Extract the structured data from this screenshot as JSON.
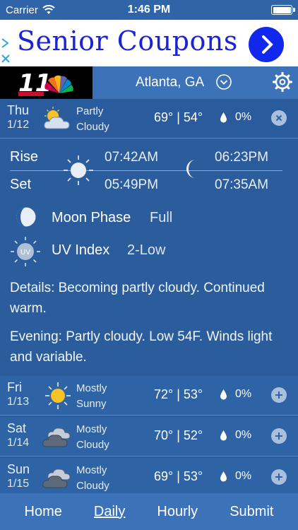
{
  "status_bar": {
    "carrier": "Carrier",
    "time": "1:46 PM"
  },
  "ad": {
    "text": "Senior Coupons"
  },
  "header": {
    "location": "Atlanta, GA"
  },
  "today": {
    "day": "Thu",
    "date": "1/12",
    "condition_line1": "Partly",
    "condition_line2": "Cloudy",
    "temps": "69° | 54°",
    "precip": "0%",
    "icon": "partly-cloudy-icon"
  },
  "details": {
    "rise_label": "Rise",
    "set_label": "Set",
    "sunrise": "07:42AM",
    "sunset": "05:49PM",
    "moonrise": "06:23PM",
    "moonset": "07:35AM",
    "moon_phase_label": "Moon Phase",
    "moon_phase_value": "Full",
    "uv_label": "UV Index",
    "uv_value": "2-Low",
    "uv_badge": "UV",
    "details_text": "Details: Becoming partly cloudy. Continued warm.",
    "evening_text": "Evening: Partly cloudy. Low 54F. Winds light and variable."
  },
  "forecast": [
    {
      "day": "Fri",
      "date": "1/13",
      "condition_line1": "Mostly",
      "condition_line2": "Sunny",
      "temps": "72° | 53°",
      "precip": "0%",
      "icon": "sunny-icon"
    },
    {
      "day": "Sat",
      "date": "1/14",
      "condition_line1": "Mostly",
      "condition_line2": "Cloudy",
      "temps": "70° | 52°",
      "precip": "0%",
      "icon": "cloudy-icon"
    },
    {
      "day": "Sun",
      "date": "1/15",
      "condition_line1": "Mostly",
      "condition_line2": "Cloudy",
      "temps": "69° | 53°",
      "precip": "0%",
      "icon": "cloudy-icon"
    }
  ],
  "nav": {
    "home": "Home",
    "daily": "Daily",
    "hourly": "Hourly",
    "submit": "Submit"
  },
  "colors": {
    "background": "#2b5d9a",
    "header": "#3b72b8",
    "ad_text": "#1a23d9",
    "sun": "#f7c325"
  }
}
